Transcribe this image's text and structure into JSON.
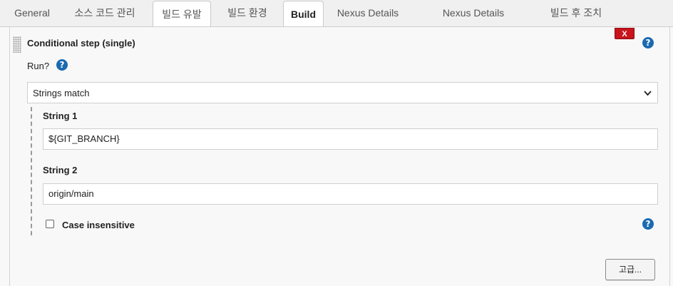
{
  "tabs": [
    {
      "label": "General"
    },
    {
      "label": "소스 코드 관리"
    },
    {
      "label": "빌드 유발"
    },
    {
      "label": "빌드 환경"
    },
    {
      "label": "Build"
    },
    {
      "label": "Nexus Details"
    },
    {
      "label": "Nexus Details"
    },
    {
      "label": "빌드 후 조치"
    }
  ],
  "active_tab": "Build",
  "step": {
    "title": "Conditional step (single)",
    "delete_label": "X",
    "help_glyph": "?"
  },
  "run": {
    "label": "Run?",
    "selected": "Strings match"
  },
  "string1": {
    "label": "String 1",
    "value": "${GIT_BRANCH}"
  },
  "string2": {
    "label": "String 2",
    "value": "origin/main"
  },
  "case_insensitive": {
    "label": "Case insensitive",
    "checked": false
  },
  "advanced_button": "고급...",
  "colors": {
    "help_blue": "#1a6ab1",
    "delete_red": "#c8141c"
  }
}
